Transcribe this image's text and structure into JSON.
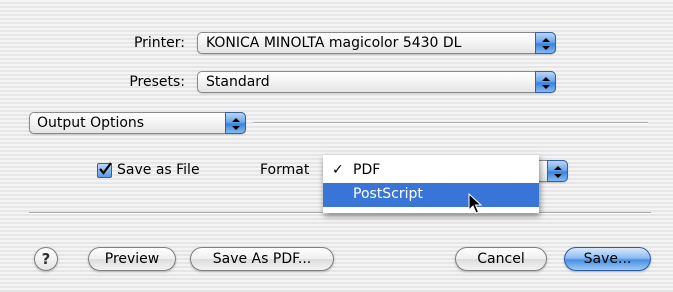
{
  "printer": {
    "label": "Printer:",
    "value": "KONICA MINOLTA magicolor 5430 DL"
  },
  "presets": {
    "label": "Presets:",
    "value": "Standard"
  },
  "panel": {
    "value": "Output Options"
  },
  "output": {
    "save_as_file_label": "Save as File",
    "save_as_file_checked": true,
    "format_label": "Format",
    "format_options": [
      {
        "label": "PDF",
        "checked": true,
        "highlighted": false
      },
      {
        "label": "PostScript",
        "checked": false,
        "highlighted": true
      }
    ]
  },
  "buttons": {
    "help": "?",
    "preview": "Preview",
    "save_as_pdf": "Save As PDF...",
    "cancel": "Cancel",
    "save": "Save..."
  },
  "colors": {
    "accent": "#3875d7",
    "default_button": "#4a8fe3"
  },
  "icons": {
    "pointer": "arrow-cursor-icon",
    "checkbox": "checkmark-icon",
    "popup": "up-down-arrows-icon"
  }
}
